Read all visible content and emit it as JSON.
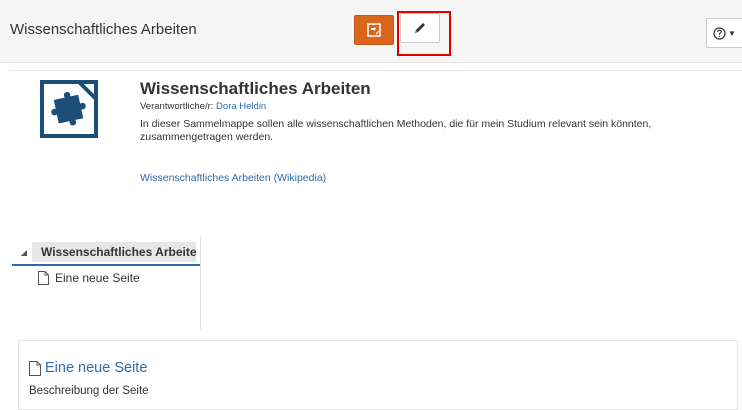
{
  "topbar": {
    "title": "Wissenschaftliches Arbeiten",
    "view_button_icon": "portfolio-view-icon",
    "edit_button_icon": "pencil-icon",
    "help_button_icon": "help-icon"
  },
  "portfolio": {
    "title": "Wissenschaftliches Arbeiten",
    "responsible_label": "Verantwortliche/r:",
    "responsible_name": "Dora Heldin",
    "description": "In dieser Sammelmappe sollen alle wissenschaftlichen Methoden, die für mein Studium relevant sein könnten, zusammengetragen werden.",
    "link": "Wissenschaftliches Arbeiten (Wikipedia)",
    "icon": "puzzle-icon"
  },
  "tree": {
    "root_label": "Wissenschaftliches Arbeiten",
    "child_label": "Eine neue Seite"
  },
  "page": {
    "title": "Eine neue Seite",
    "description": "Beschreibung der Seite"
  },
  "colors": {
    "accent_orange": "#d8661d",
    "link_blue": "#2e6ba8",
    "icon_navy": "#1b4f7a",
    "highlight_red": "#e00000"
  }
}
